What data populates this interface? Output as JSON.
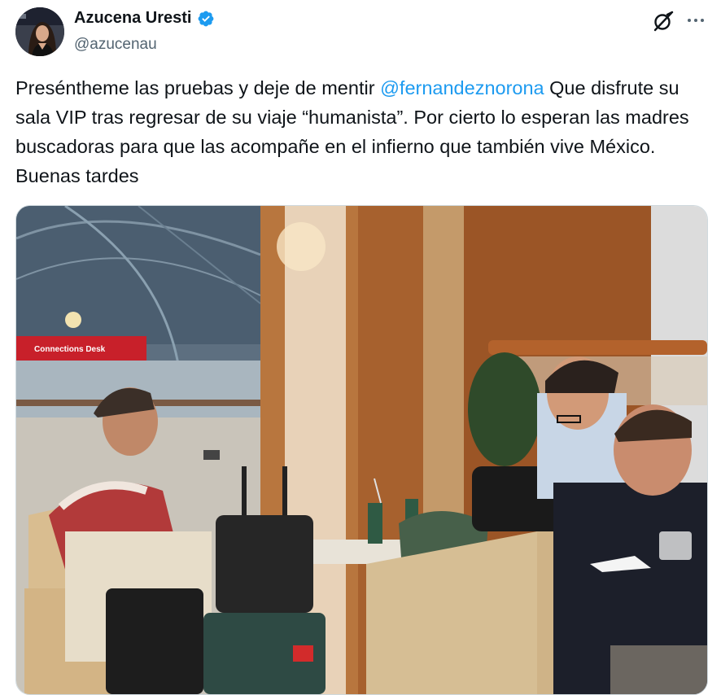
{
  "author": {
    "display_name": "Azucena Uresti",
    "handle": "@azucenau",
    "verified": true,
    "verified_color": "#1d9bf0",
    "avatar_icon": "profile-photo"
  },
  "actions": {
    "grok_icon": "grok-icon",
    "more_icon": "more-options-icon"
  },
  "tweet": {
    "text_part1": "Preséntheme las pruebas y deje de mentir ",
    "mention": "@fernandeznorona",
    "text_part2": " Que disfrute su sala VIP tras regresar de su viaje “humanista”. Por cierto lo esperan las madres buscadoras para que las acompañe en el infierno que también vive México. Buenas tardes",
    "mention_color": "#1d9bf0"
  },
  "media": {
    "sign_text": "Connections Desk",
    "sign_color": "#c8202a"
  }
}
